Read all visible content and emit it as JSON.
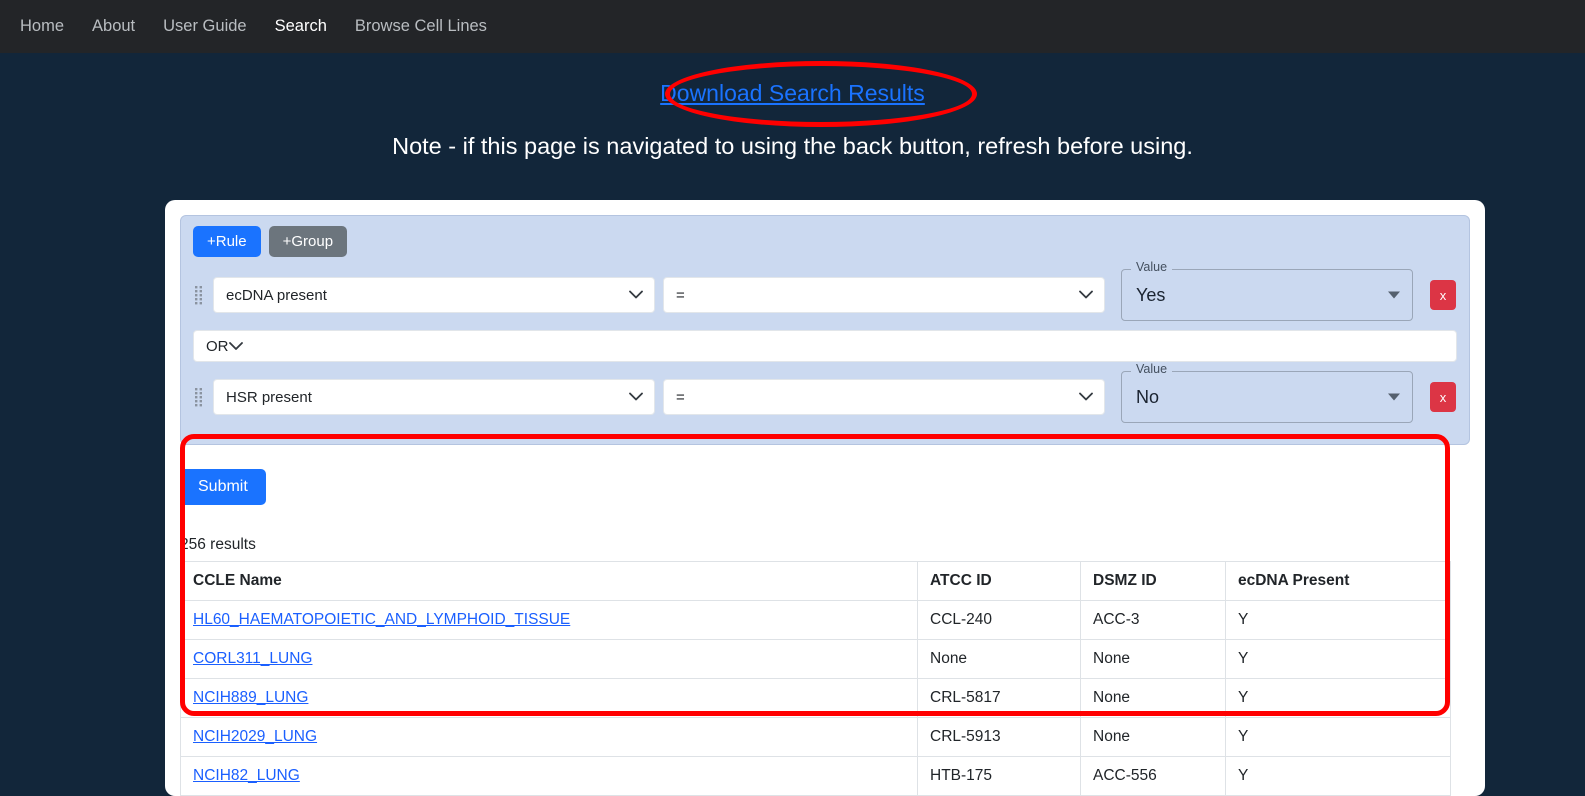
{
  "navbar": {
    "items": [
      {
        "label": "Home",
        "active": false
      },
      {
        "label": "About",
        "active": false
      },
      {
        "label": "User Guide",
        "active": false
      },
      {
        "label": "Search",
        "active": true
      },
      {
        "label": "Browse Cell Lines",
        "active": false
      }
    ]
  },
  "header": {
    "download_link": "Download Search Results",
    "note": "Note - if this page is navigated to using the back button, refresh before using."
  },
  "query_builder": {
    "add_rule_label": "+Rule",
    "add_group_label": "+Group",
    "remove_label": "x",
    "combinator": "OR",
    "value_legend": "Value",
    "rules": [
      {
        "field": "ecDNA present",
        "operator": "=",
        "value": "Yes"
      },
      {
        "field": "HSR present",
        "operator": "=",
        "value": "No"
      }
    ]
  },
  "results": {
    "submit_label": "Submit",
    "count_text": "256 results",
    "columns": [
      "CCLE Name",
      "ATCC ID",
      "DSMZ ID",
      "ecDNA Present"
    ],
    "rows": [
      {
        "ccle_name": "HL60_HAEMATOPOIETIC_AND_LYMPHOID_TISSUE",
        "atcc_id": "CCL-240",
        "dsmz_id": "ACC-3",
        "ecdna_present": "Y"
      },
      {
        "ccle_name": "CORL311_LUNG",
        "atcc_id": "None",
        "dsmz_id": "None",
        "ecdna_present": "Y"
      },
      {
        "ccle_name": "NCIH889_LUNG",
        "atcc_id": "CRL-5817",
        "dsmz_id": "None",
        "ecdna_present": "Y"
      },
      {
        "ccle_name": "NCIH2029_LUNG",
        "atcc_id": "CRL-5913",
        "dsmz_id": "None",
        "ecdna_present": "Y"
      },
      {
        "ccle_name": "NCIH82_LUNG",
        "atcc_id": "HTB-175",
        "dsmz_id": "ACC-556",
        "ecdna_present": "Y"
      }
    ]
  },
  "annotations": {
    "ellipse_color": "#ff0000",
    "rect_color": "#ff0000"
  },
  "colors": {
    "page_background": "#12263a",
    "navbar_background": "#232528",
    "panel_background": "#cbd9f0",
    "primary_blue": "#1a73ff",
    "danger_red": "#dc3545",
    "link_blue": "#1a5fff"
  }
}
